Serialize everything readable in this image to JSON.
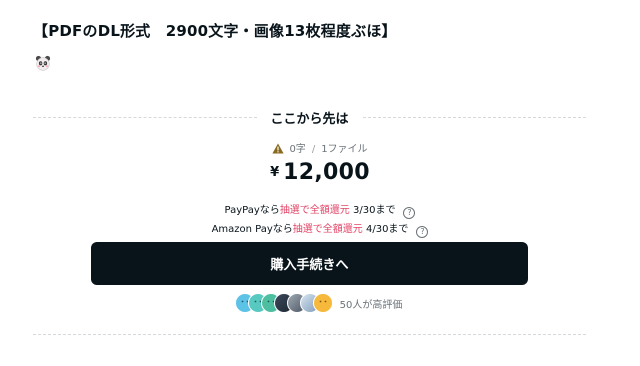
{
  "headline": "【PDFのDL形式　2900文字・画像13枚程度ぶほ】",
  "divider_label": "ここから先は",
  "meta": {
    "chars": "0字",
    "separator": "/",
    "files": "1ファイル"
  },
  "price": {
    "currency": "¥",
    "amount": "12,000"
  },
  "promos": [
    {
      "prefix": "PayPayなら",
      "highlight": "抽選で全額還元",
      "suffix": " 3/30まで"
    },
    {
      "prefix": "Amazon Payなら",
      "highlight": "抽選で全額還元",
      "suffix": " 4/30まで"
    }
  ],
  "help_glyph": "?",
  "cta_label": "購入手続きへ",
  "likes_text": "50人が高評価",
  "avatars": [
    {
      "color": "#5cc2e6",
      "icon": "smiley-avatar"
    },
    {
      "color": "#58c9c0",
      "icon": "smiley-avatar"
    },
    {
      "color": "#4dbfa0",
      "icon": "smiley-avatar"
    },
    {
      "color": "#3c4a5c",
      "icon": "photo-avatar"
    },
    {
      "color": "#6f7f8f",
      "icon": "photo-avatar"
    },
    {
      "color": "#9bb8d8",
      "icon": "photo-avatar"
    },
    {
      "color": "#f6b93b",
      "icon": "smiley-avatar"
    }
  ],
  "colors": {
    "text": "#08131a",
    "muted": "#6b7378",
    "accent": "#e24567",
    "cta_bg": "#08131a",
    "warning": "#8a6a1f"
  }
}
